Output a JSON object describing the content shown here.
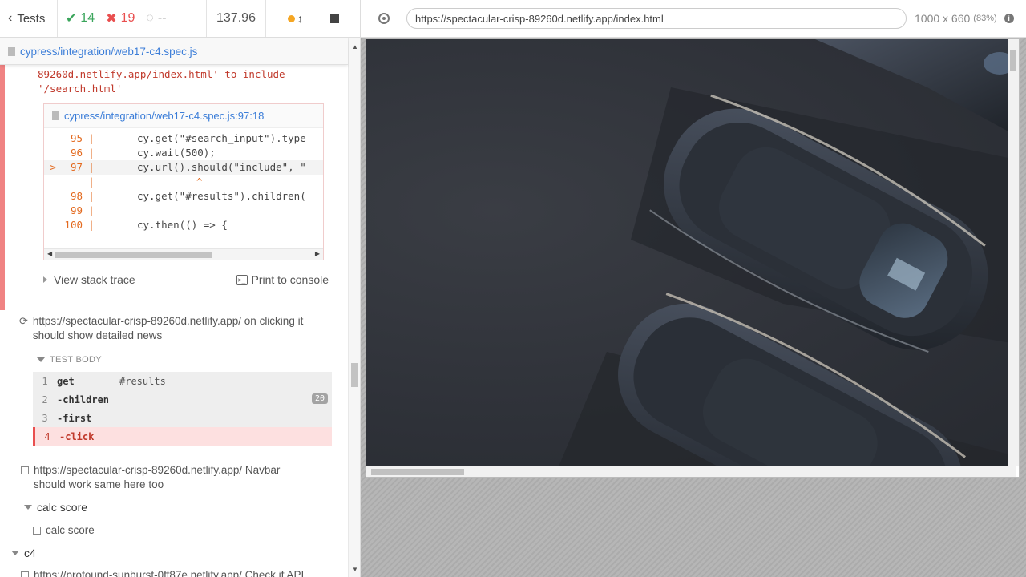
{
  "header": {
    "tests_label": "Tests",
    "passed": "14",
    "failed": "19",
    "pending": "--",
    "duration": "137.96"
  },
  "spec": {
    "file": "cypress/integration/web17-c4.spec.js"
  },
  "error": {
    "message_line1": "89260d.netlify.app/index.html' to include",
    "message_line2": "'/search.html'",
    "code_frame_file": "cypress/integration/web17-c4.spec.js:97:18",
    "view_stack_trace": "View stack trace",
    "print_to_console": "Print to console",
    "lines": [
      {
        "arrow": "",
        "num": "95",
        "code": "cy.get(\"#search_input\").type"
      },
      {
        "arrow": "",
        "num": "96",
        "code": "cy.wait(500);"
      },
      {
        "arrow": ">",
        "num": "97",
        "code": "cy.url().should(\"include\", \""
      },
      {
        "arrow": "",
        "num": "",
        "code": "^"
      },
      {
        "arrow": "",
        "num": "98",
        "code": "cy.get(\"#results\").children("
      },
      {
        "arrow": "",
        "num": "99",
        "code": ""
      },
      {
        "arrow": "",
        "num": "100",
        "code": "cy.then(() => {"
      }
    ]
  },
  "tests": {
    "running_test": "https://spectacular-crisp-89260d.netlify.app/ on clicking it should show detailed news",
    "test_body_label": "TEST BODY",
    "commands": [
      {
        "num": "1",
        "name": "get",
        "msg": "#results",
        "badge": ""
      },
      {
        "num": "2",
        "name": "-children",
        "msg": "",
        "badge": "20"
      },
      {
        "num": "3",
        "name": "-first",
        "msg": "",
        "badge": ""
      },
      {
        "num": "4",
        "name": "-click",
        "msg": "",
        "badge": ""
      }
    ],
    "navbar_test": "https://spectacular-crisp-89260d.netlify.app/ Navbar should work same here too",
    "suite_calc": "calc score",
    "test_calc": "calc score",
    "suite_c4": "c4",
    "api_test": "https://profound-sunburst-0ff87e.netlify.app/ Check if API"
  },
  "aut": {
    "url": "https://spectacular-crisp-89260d.netlify.app/index.html",
    "viewport": "1000 x 660",
    "scale": "(83%)"
  },
  "colors": {
    "pass": "#3aa55b",
    "fail": "#e94f4f",
    "pending": "#f5a623",
    "link": "#3b7dd8"
  }
}
